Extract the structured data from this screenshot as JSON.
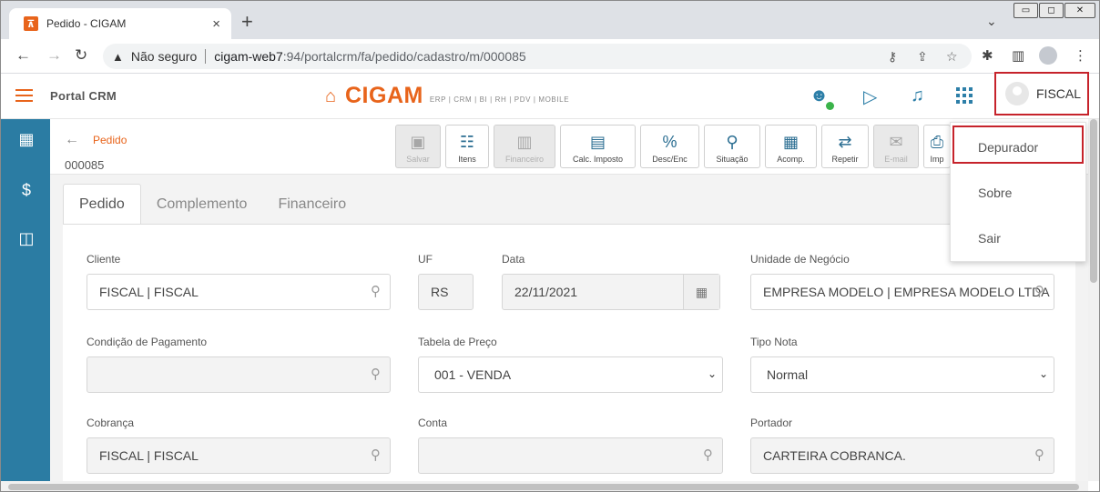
{
  "browser": {
    "tab_title": "Pedido - CIGAM",
    "tab_close": "×",
    "new_tab": "+",
    "not_secure": "Não seguro",
    "url_host": "cigam-web7",
    "url_rest": ":94/portalcrm/fa/pedido/cadastro/m/000085"
  },
  "header": {
    "portal": "Portal CRM",
    "logo_text": "CIGAM",
    "logo_sub": "ERP | CRM | BI | RH | PDV | MOBILE",
    "user": "FISCAL"
  },
  "page": {
    "breadcrumb": "Pedido",
    "code": "000085"
  },
  "toolbar": [
    {
      "label": "Salvar",
      "icon": "save-icon",
      "disabled": true
    },
    {
      "label": "Itens",
      "icon": "list-icon",
      "disabled": false
    },
    {
      "label": "Financeiro",
      "icon": "finance-icon",
      "disabled": true
    },
    {
      "label": "Calc. Imposto",
      "icon": "calculator-icon",
      "disabled": false
    },
    {
      "label": "Desc/Enc",
      "icon": "percent-icon",
      "disabled": false
    },
    {
      "label": "Situação",
      "icon": "route-icon",
      "disabled": false
    },
    {
      "label": "Acomp.",
      "icon": "clipboard-icon",
      "disabled": false
    },
    {
      "label": "Repetir",
      "icon": "repeat-icon",
      "disabled": false
    },
    {
      "label": "E-mail",
      "icon": "email-icon",
      "disabled": true
    },
    {
      "label": "Imp",
      "icon": "print-icon",
      "disabled": false
    }
  ],
  "tabs": [
    "Pedido",
    "Complemento",
    "Financeiro"
  ],
  "form": {
    "cliente_label": "Cliente",
    "cliente_value": "FISCAL | FISCAL",
    "uf_label": "UF",
    "uf_value": "RS",
    "data_label": "Data",
    "data_value": "22/11/2021",
    "unidade_label": "Unidade de Negócio",
    "unidade_value": "EMPRESA MODELO | EMPRESA MODELO LTDA",
    "condicao_label": "Condição de Pagamento",
    "condicao_value": "",
    "tabela_label": "Tabela de Preço",
    "tabela_value": "001 - VENDA",
    "tipo_label": "Tipo Nota",
    "tipo_value": "Normal",
    "cobranca_label": "Cobrança",
    "cobranca_value": "FISCAL | FISCAL",
    "conta_label": "Conta",
    "conta_value": "",
    "portador_label": "Portador",
    "portador_value": "CARTEIRA COBRANCA."
  },
  "user_menu": [
    "Depurador",
    "Sobre",
    "Sair"
  ],
  "colors": {
    "accent": "#e8641b",
    "sidebar": "#2b7ca3",
    "highlight": "#c6232b"
  }
}
